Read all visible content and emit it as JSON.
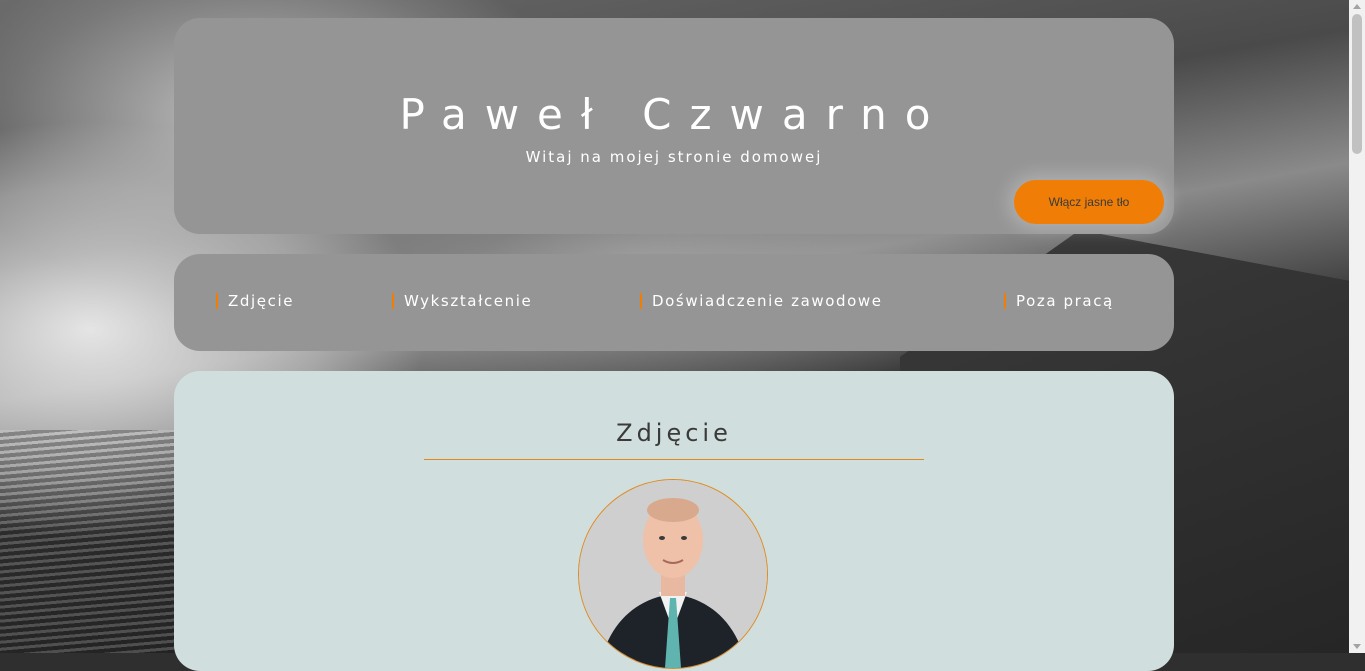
{
  "header": {
    "title": "Paweł Czwarno",
    "subtitle": "Witaj na mojej stronie domowej",
    "theme_button": "Włącz jasne tło"
  },
  "nav": {
    "items": [
      {
        "label": "Zdjęcie"
      },
      {
        "label": "Wykształcenie"
      },
      {
        "label": "Doświadczenie zawodowe"
      },
      {
        "label": "Poza pracą"
      }
    ]
  },
  "section": {
    "title": "Zdjęcie"
  },
  "colors": {
    "accent": "#f07e06",
    "card": "#959595",
    "content": "#d0dedd"
  },
  "icons": {
    "avatar": "profile-photo"
  }
}
